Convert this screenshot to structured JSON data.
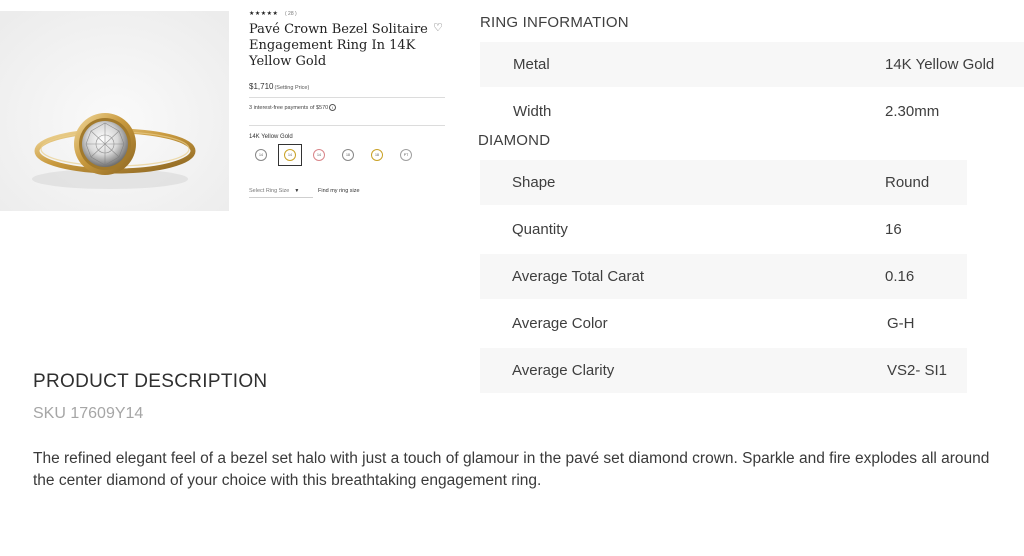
{
  "product": {
    "rating_stars": "★★★★★",
    "review_count": "( 28 )",
    "title": "Pavé Crown Bezel Solitaire Engagement Ring In 14K Yellow Gold",
    "price": "$1,710",
    "price_note": "(Setting Price)",
    "installments": "3 interest-free payments of $570",
    "selected_metal": "14K Yellow Gold",
    "metal_swatches": [
      {
        "label": "14",
        "ring_color": "#9a9a9a"
      },
      {
        "label": "14",
        "ring_color": "#c9a227"
      },
      {
        "label": "14",
        "ring_color": "#d9868a"
      },
      {
        "label": "18",
        "ring_color": "#9a9a9a"
      },
      {
        "label": "18",
        "ring_color": "#c9a227"
      },
      {
        "label": "PT",
        "ring_color": "#a0a0a0"
      }
    ],
    "ring_size_placeholder": "Select Ring Size",
    "find_size_link": "Find my ring size"
  },
  "ring_information": {
    "heading": "RING INFORMATION",
    "rows": [
      {
        "key": "Metal",
        "value": "14K Yellow Gold"
      },
      {
        "key": "Width",
        "value": "2.30mm"
      }
    ]
  },
  "diamond": {
    "heading": "DIAMOND",
    "rows": [
      {
        "key": "Shape",
        "value": "Round"
      },
      {
        "key": "Quantity",
        "value": "16"
      },
      {
        "key": "Average Total Carat",
        "value": "0.16"
      },
      {
        "key": "Average Color",
        "value": "G-H"
      },
      {
        "key": "Average Clarity",
        "value": "VS2- SI1"
      }
    ]
  },
  "description": {
    "heading": "PRODUCT DESCRIPTION",
    "sku": "SKU 17609Y14",
    "text": "The refined elegant feel of a bezel set halo with just a touch of glamour in the pavé set diamond crown. Sparkle and fire explodes all around the center diamond of your choice with this breathtaking engagement ring."
  },
  "colors": {
    "gold": "#c9a227",
    "row_alt": "#f7f7f7"
  }
}
